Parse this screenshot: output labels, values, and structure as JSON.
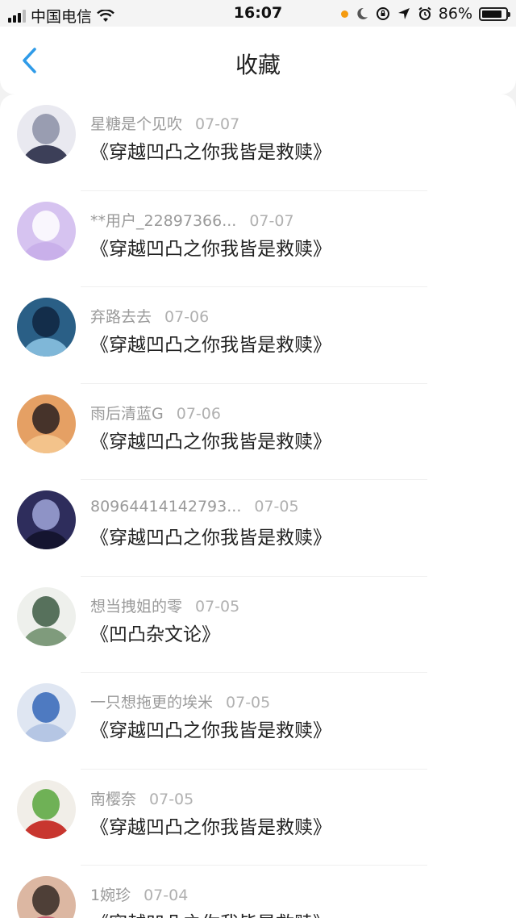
{
  "status": {
    "carrier": "中国电信",
    "time": "16:07",
    "battery": "86%",
    "battery_level": 0.86
  },
  "header": {
    "title": "收藏"
  },
  "items": [
    {
      "user": "星糖是个见吹",
      "date": "07-07",
      "title": "《穿越凹凸之你我皆是救赎》",
      "avatar_colors": [
        "#e9e9f0",
        "#8b8fa6",
        "#3c3f58"
      ]
    },
    {
      "user": "**用户_22897366...",
      "date": "07-07",
      "title": "《穿越凹凸之你我皆是救赎》",
      "avatar_colors": [
        "#d6c3f0",
        "#ffffff",
        "#c9b0ea"
      ]
    },
    {
      "user": "弃路去去",
      "date": "07-06",
      "title": "《穿越凹凸之你我皆是救赎》",
      "avatar_colors": [
        "#2a5f86",
        "#0f2540",
        "#7fb7d8"
      ]
    },
    {
      "user": "雨后清蓝G",
      "date": "07-06",
      "title": "《穿越凹凸之你我皆是救赎》",
      "avatar_colors": [
        "#e5a064",
        "#2a2020",
        "#f3c38b"
      ]
    },
    {
      "user": "80964414142793...",
      "date": "07-05",
      "title": "《穿越凹凸之你我皆是救赎》",
      "avatar_colors": [
        "#2e2d5c",
        "#9fa6d8",
        "#151530"
      ]
    },
    {
      "user": "想当拽姐的零",
      "date": "07-05",
      "title": "《凹凸杂文论》",
      "avatar_colors": [
        "#eef0ec",
        "#3c5a43",
        "#7f9b7c"
      ]
    },
    {
      "user": "一只想拖更的埃米",
      "date": "07-05",
      "title": "《穿越凹凸之你我皆是救赎》",
      "avatar_colors": [
        "#dfe6f2",
        "#3566b8",
        "#b5c6e4"
      ]
    },
    {
      "user": "南樱奈",
      "date": "07-05",
      "title": "《穿越凹凸之你我皆是救赎》",
      "avatar_colors": [
        "#f1eee8",
        "#58a63c",
        "#c8362f"
      ]
    },
    {
      "user": "1婉珍",
      "date": "07-04",
      "title": "《穿越凹凸之你我皆是救赎》",
      "avatar_colors": [
        "#dcb7a2",
        "#352a24",
        "#c25a6d"
      ]
    }
  ]
}
